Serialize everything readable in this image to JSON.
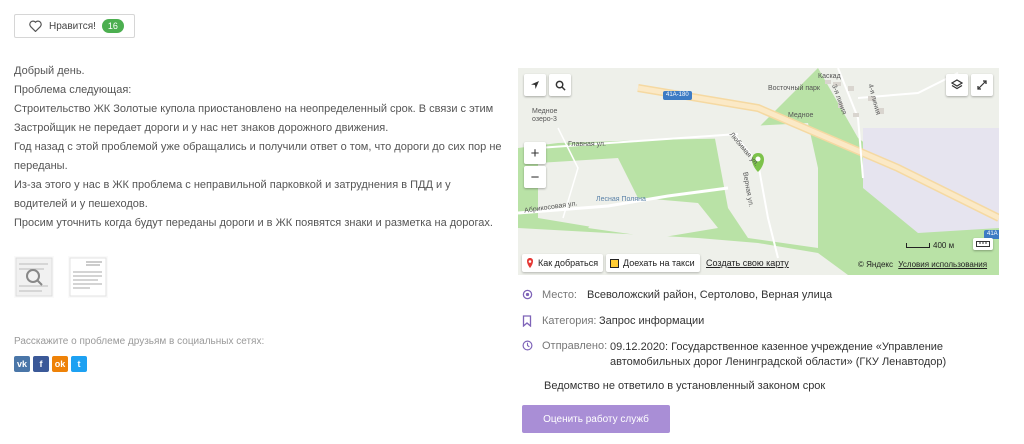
{
  "like": {
    "label": "Нравится!",
    "count": "16"
  },
  "description": [
    "Добрый день.",
    "Проблема следующая:",
    "Строительство ЖК Золотые купола приостановлено на неопределенный срок. В связи с этим",
    "Застройщик не передает дороги и у нас нет знаков дорожного движения.",
    "Год назад с этой проблемой уже обращались и получили ответ о том, что дороги до сих пор не",
    "переданы.",
    "Из-за этого у нас в ЖК проблема с неправильной парковкой и затруднения в ПДД и у",
    "водителей и у пешеходов.",
    "Просим уточнить когда будут переданы дороги и в ЖК появятся знаки и разметка на дорогах."
  ],
  "share": {
    "text": "Расскажите о проблеме друзьям в социальных сетях:",
    "networks": [
      {
        "icon": "vk",
        "glyph": "vk",
        "color": "#4a76a8"
      },
      {
        "icon": "facebook",
        "glyph": "f",
        "color": "#3b5998"
      },
      {
        "icon": "odnoklassniki",
        "glyph": "ok",
        "color": "#ee8208"
      },
      {
        "icon": "twitter",
        "glyph": "t",
        "color": "#1da1f2"
      }
    ]
  },
  "map": {
    "take_route": "Как добраться",
    "taxi": "Доехать на такси",
    "create_map": "Создать свою карту",
    "scale": "400 м",
    "copyright": "© Яндекс",
    "terms": "Условия использования",
    "labels": {
      "kaskad": "Каскад",
      "vostochny": "Восточный парк",
      "mednoe": "Медное",
      "mednoe_ozero": "Медное\nозеро-3",
      "glavnaya": "Главная ул.",
      "lyubimaya": "Любимая ул.",
      "vernaya": "Верная ул.",
      "abrikosovaya": "Абрикосовая ул.",
      "lesnaya": "Лесная Поляна",
      "third_line": "3-я линия",
      "fourth_line": "4-я линия",
      "road_a": "41А-180",
      "road_b": "41А"
    }
  },
  "info": {
    "place_label": "Место:",
    "place_value": "Всеволожский район, Сертолово, Верная улица",
    "category_label": "Категория:",
    "category_value": "Запрос информации",
    "sent_label": "Отправлено:",
    "sent_value_1": "09.12.2020: Государственное казенное учреждение «Управление",
    "sent_value_2": "автомобильных дорог Ленинградской области» (ГКУ Ленавтодор)"
  },
  "notice": "Ведомство не ответило в установленный законом срок",
  "rate_button": "Оценить работу служб"
}
